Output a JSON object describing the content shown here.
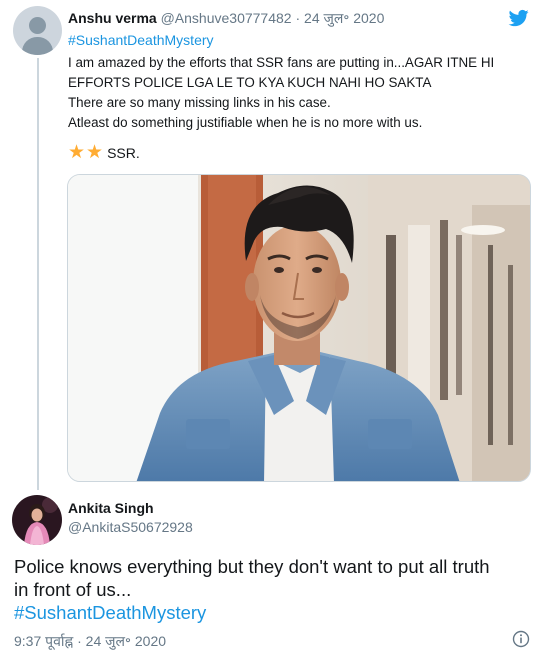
{
  "tweet1": {
    "author_name": "Anshu verma",
    "handle": "@Anshuve30777482",
    "separator": " · ",
    "date": "24 जुल॰ 2020",
    "hashtag": "#SushantDeathMystery",
    "lines": [
      "I am amazed by the efforts that SSR fans are putting in...AGAR ITNE HI",
      "EFFORTS POLICE LGA LE TO KYA KUCH NAHI HO SAKTA",
      "There are so many missing links in his case.",
      "Atleast do something justifiable when he is no more with us."
    ],
    "emoji": [
      "star-emoji",
      "star-emoji"
    ],
    "ssr_text": "SSR."
  },
  "tweet2": {
    "author_name": "Ankita Singh",
    "handle": "@AnkitaS50672928",
    "lines": [
      "Police knows everything but they don't want to put all truth",
      "in front of us..."
    ],
    "hashtag": "#SushantDeathMystery",
    "time": "9:37 पूर्वाह्न",
    "separator": " · ",
    "date": "24 जुल॰ 2020"
  },
  "colors": {
    "link": "#1b95e0",
    "secondary_text": "#657786",
    "twitter_blue": "#1da1f2",
    "star": "#ffac33"
  }
}
